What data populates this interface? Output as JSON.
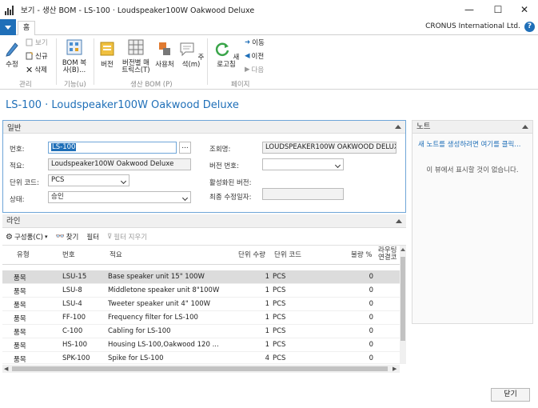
{
  "window": {
    "title": "보기 - 생산 BOM - LS-100 · Loudspeaker100W Oakwood Deluxe",
    "minimize": "—",
    "maximize": "☐",
    "close": "✕"
  },
  "ribbon": {
    "tab": "홈",
    "company": "CRONUS International Ltd.",
    "help": "?",
    "groups": {
      "manage": {
        "label": "관리",
        "edit": "수정",
        "view": "보기",
        "new": "신규",
        "delete": "삭제"
      },
      "function": {
        "label": "기능(u)",
        "copy_bom": [
          "BOM 복",
          "사(B)..."
        ]
      },
      "production_bom": {
        "label": "생산 BOM (P)",
        "versions": "버전",
        "matrix": [
          "버전별 매",
          "트릭스(T)"
        ],
        "where_used": "사용처",
        "comments": "주석(m)"
      },
      "page": {
        "label": "페이지",
        "refresh": "새로고침",
        "next": "이동",
        "previous": "이전",
        "next2": "다음"
      }
    }
  },
  "page_title": "LS-100 · Loudspeaker100W Oakwood Deluxe",
  "general": {
    "header": "일반",
    "fields": {
      "no_label": "번호:",
      "no_value": "LS-100",
      "assist": "...",
      "description_label": "적요:",
      "description_value": "Loudspeaker100W Oakwood Deluxe",
      "uom_label": "단위 코드:",
      "uom_value": "PCS",
      "status_label": "상태:",
      "status_value": "승인",
      "search_name_label": "조회명:",
      "search_name_value": "LOUDSPEAKER100W OAKWOOD DELUXE",
      "version_nos_label": "버전 번호:",
      "version_nos_value": "",
      "active_version_label": "활성화된 버전:",
      "last_modified_label": "최종 수정일자:",
      "last_modified_value": ""
    }
  },
  "lines": {
    "header": "라인",
    "toolbar": {
      "component": "구성품(C)",
      "find": "찾기",
      "filter": "필터",
      "clear_filter": "필터 지우기"
    },
    "columns": [
      "유형",
      "번호",
      "적요",
      "단위 수량",
      "단위 코드",
      "불량 %",
      "라우팅\n연결코"
    ],
    "rows": [
      {
        "type": "품목",
        "no": "LSU-15",
        "desc": "Base speaker unit 15\" 100W",
        "qty": "1",
        "uom": "PCS",
        "scrap": "0"
      },
      {
        "type": "품목",
        "no": "LSU-8",
        "desc": "Middletone speaker unit 8\"100W",
        "qty": "1",
        "uom": "PCS",
        "scrap": "0"
      },
      {
        "type": "품목",
        "no": "LSU-4",
        "desc": "Tweeter speaker unit 4\" 100W",
        "qty": "1",
        "uom": "PCS",
        "scrap": "0"
      },
      {
        "type": "품목",
        "no": "FF-100",
        "desc": "Frequency filter for LS-100",
        "qty": "1",
        "uom": "PCS",
        "scrap": "0"
      },
      {
        "type": "품목",
        "no": "C-100",
        "desc": "Cabling for LS-100",
        "qty": "1",
        "uom": "PCS",
        "scrap": "0"
      },
      {
        "type": "품목",
        "no": "HS-100",
        "desc": "Housing LS-100,Oakwood 120 ...",
        "qty": "1",
        "uom": "PCS",
        "scrap": "0"
      },
      {
        "type": "품목",
        "no": "SPK-100",
        "desc": "Spike for LS-100",
        "qty": "4",
        "uom": "PCS",
        "scrap": "0"
      }
    ]
  },
  "notes": {
    "header": "노트",
    "link": "새 노트를 생성하려면 여기를 클릭...",
    "empty": "이 뷰에서 표시할 것이 없습니다."
  },
  "footer": {
    "close": "닫기"
  },
  "colors": {
    "accent": "#1f6fb8",
    "selected_row": "#dcdcdc",
    "panel_border": "#6fa6d8"
  }
}
